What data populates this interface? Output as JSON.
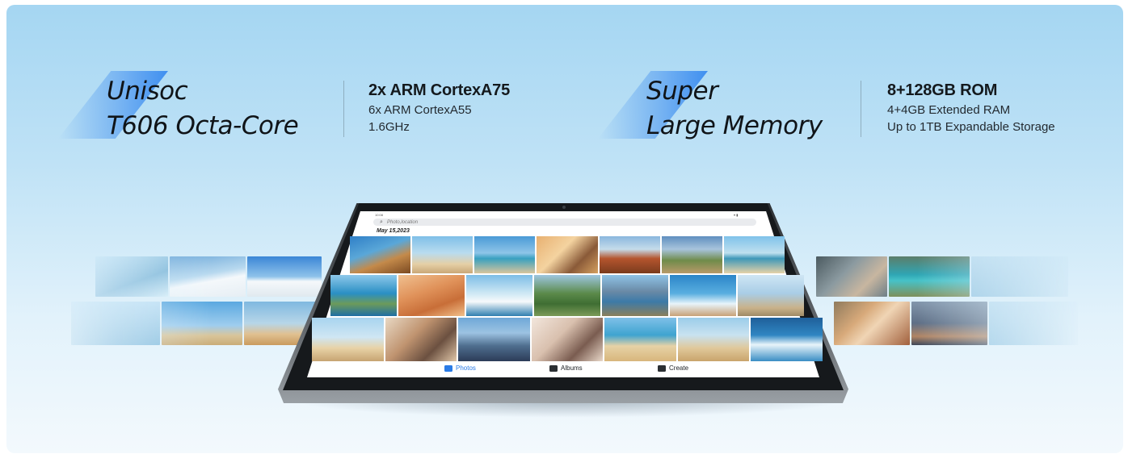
{
  "left_spec": {
    "headline_line1": "Unisoc",
    "headline_line2": "T606 Octa-Core",
    "detail_main": "2x ARM CortexA75",
    "detail_line1": "6x ARM CortexA55",
    "detail_line2": "1.6GHz"
  },
  "right_spec": {
    "headline_line1": "Super",
    "headline_line2": "Large Memory",
    "detail_main": "8+128GB ROM",
    "detail_line1": "4+4GB Extended RAM",
    "detail_line2": "Up to 1TB Expandable Storage"
  },
  "tablet": {
    "status_time": "10:08",
    "status_icons": "▾ ▮",
    "search_placeholder": "Photo,location",
    "date_label": "May 15,2023",
    "nav": {
      "photos_label": "Photos",
      "albums_label": "Albums",
      "create_label": "Create"
    }
  },
  "colors": {
    "accent_blue": "#3f8ff0",
    "nav_active": "#2a7be6",
    "background_top": "#a5d6f2",
    "background_bottom": "#f3f9fd"
  },
  "photo_themes": {
    "row1": [
      "coral-reef",
      "beach-friends",
      "beach-car",
      "woman-hat-street",
      "desert-mesa",
      "mountain-village",
      "beach-chairs"
    ],
    "row2": [
      "coastal-cliffs",
      "sand-dunes",
      "jet-ski",
      "hiker-valley",
      "tourist-lake",
      "surfer",
      "woman-balloon"
    ],
    "row3": [
      "beach-volleyball",
      "couple-portrait",
      "city-skyline",
      "woman-laptop",
      "kids-beach",
      "surfers-walking",
      "wave-surfing"
    ],
    "left_strip": [
      "sea-blur",
      "skier",
      "snowboarder",
      "sky-blur",
      "jumping-beach",
      "surfboard-girl"
    ],
    "right_strip": [
      "couple-laughing",
      "turquoise-lake",
      "sky-blur",
      "smiling-woman",
      "city-blur",
      "sky-blur"
    ]
  }
}
